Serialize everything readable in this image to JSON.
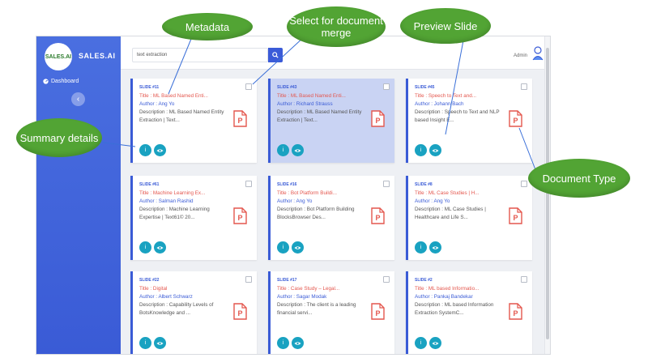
{
  "app": {
    "logo_text": "SALES.AI",
    "logo_mark": "SALES.AI",
    "nav_dashboard": "Dashboard",
    "search_value": "text extraction",
    "user_name": "Admin"
  },
  "cards": [
    {
      "slide": "SLIDE #11",
      "title": "Title : ML Based Named Enti...",
      "author": "Author : Ang Yo",
      "description": "Description : ML Based Named Entity Extraction | Text...",
      "selected": false
    },
    {
      "slide": "SLIDE #43",
      "title": "Title : ML Based Named Enti...",
      "author": "Author : Richard Strauss",
      "description": "Description : ML Based Named Entity Extraction | Text...",
      "selected": true
    },
    {
      "slide": "SLIDE #45",
      "title": "Title : Speech to Text and...",
      "author": "Author : Johann Bach",
      "description": "Description : Speech to Text and NLP based Insight E...",
      "selected": false
    },
    {
      "slide": "SLIDE #61",
      "title": "Title : Machine Learning Ex...",
      "author": "Author : Salman Rashid",
      "description": "Description : Machine Learning Expertise | Text61© 20...",
      "selected": false
    },
    {
      "slide": "SLIDE #16",
      "title": "Title : Bot Platform Buildi...",
      "author": "Author : Ang Yo",
      "description": "Description : Bot Platform Building BlocksBrowser Des...",
      "selected": false
    },
    {
      "slide": "SLIDE #8",
      "title": "Title : ML Case Studies | H...",
      "author": "Author : Ang Yo",
      "description": "Description : ML Case Studies | Healthcare and Life S...",
      "selected": false
    },
    {
      "slide": "SLIDE #22",
      "title": "Title : Digital",
      "author": "Author : Albert Schwarz",
      "description": "Description : Capability Levels of BotsKnowledge and ...",
      "selected": false
    },
    {
      "slide": "SLIDE #17",
      "title": "Title : Case Study – Legal...",
      "author": "Author : Sagar Modak",
      "description": "Description : The client is a leading financial servi...",
      "selected": false
    },
    {
      "slide": "SLIDE #2",
      "title": "Title : ML based Informatio...",
      "author": "Author : Pankaj Bandekar",
      "description": "Description : ML based Information Extraction SystemC...",
      "selected": false
    }
  ],
  "callouts": {
    "metadata": "Metadata",
    "select_merge": "Select for document merge",
    "preview": "Preview Slide",
    "summary": "Summary details",
    "doctype": "Document Type"
  },
  "colors": {
    "accent": "#3a5bd6",
    "title_red": "#e4574e",
    "action_teal": "#19a2c1",
    "callout_green": "#52a434"
  }
}
